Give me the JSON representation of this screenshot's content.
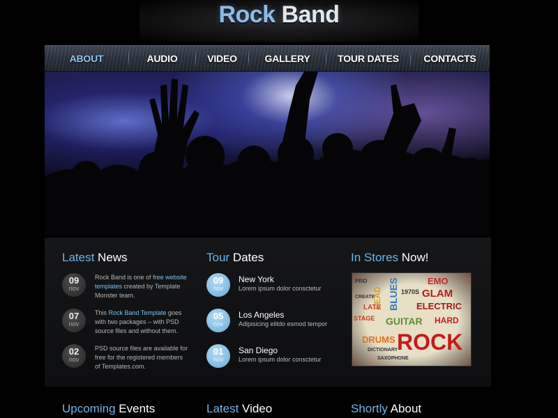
{
  "header": {
    "title_part1": "Rock",
    "title_part2": "Band"
  },
  "nav": {
    "items": [
      {
        "label": "ABOUT",
        "active": true
      },
      {
        "label": "AUDIO",
        "active": false
      },
      {
        "label": "VIDEO",
        "active": false
      },
      {
        "label": "GALLERY",
        "active": false
      },
      {
        "label": "TOUR DATES",
        "active": false
      },
      {
        "label": "CONTACTS",
        "active": false
      }
    ]
  },
  "latest_news": {
    "title_highlight": "Latest",
    "title_rest": "News",
    "items": [
      {
        "day": "09",
        "month": "nov",
        "text_before": "Rock Band is one of ",
        "link": "free website templates",
        "text_after": " created by Template Monster team."
      },
      {
        "day": "07",
        "month": "nov",
        "text_before": "This ",
        "link": "Rock Band Template",
        "text_after": " goes with two packages – with PSD source files and without them."
      },
      {
        "day": "02",
        "month": "nov",
        "text_before": "PSD source files are available for free for the registered members of Templates.com.",
        "link": "",
        "text_after": ""
      }
    ]
  },
  "tour_dates": {
    "title_highlight": "Tour",
    "title_rest": "Dates",
    "items": [
      {
        "day": "09",
        "month": "nov",
        "city": "New York",
        "desc": "Lorem ipsum dolor consctetur"
      },
      {
        "day": "05",
        "month": "nov",
        "city": "Los Angeles",
        "desc": "Adipisicing elitdo esmod tempor"
      },
      {
        "day": "01",
        "month": "nov",
        "city": "San Diego",
        "desc": "Lorem ipsum dolor consctetur"
      }
    ]
  },
  "in_stores": {
    "title_highlight": "In Stores",
    "title_rest": "Now!",
    "poster_words": [
      "EMO",
      "GLAM",
      "LEAD",
      "BLUES",
      "1970S",
      "ELECTRIC",
      "GUITAR",
      "HARD",
      "DRUMS",
      "ROCK",
      "LATE",
      "STAGE",
      "CREATE",
      "SAXOPHONE",
      "DICTIONARY",
      "PRO"
    ]
  },
  "bottom": {
    "upcoming": {
      "hl": "Upcoming",
      "rest": "Events"
    },
    "video": {
      "hl": "Latest",
      "rest": "Video"
    },
    "about": {
      "hl": "Shortly",
      "rest": "About"
    }
  },
  "colors": {
    "accent": "#6fb4e8",
    "background": "#000000",
    "panel": "#131416"
  }
}
